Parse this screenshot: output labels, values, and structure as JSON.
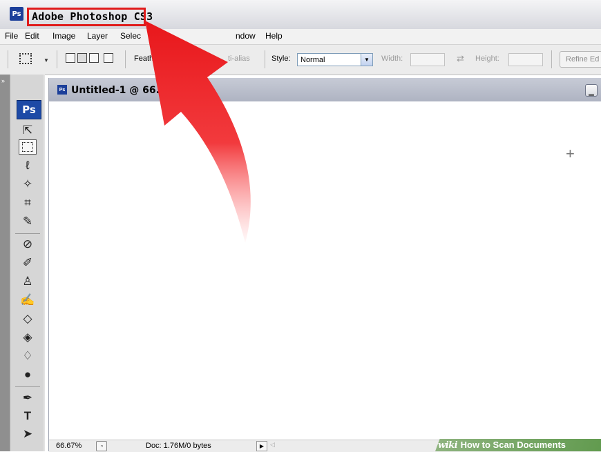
{
  "titlebar": {
    "app_icon": "Ps",
    "title": "Adobe Photoshop CS3"
  },
  "menu": [
    "File",
    "Edit",
    "Image",
    "Layer",
    "Selec",
    "ndow",
    "Help"
  ],
  "options_bar": {
    "feather_label": "Feath",
    "antialias_label": "ti-alias",
    "style_label": "Style:",
    "style_value": "Normal",
    "width_label": "Width:",
    "height_label": "Height:",
    "refine_label": "Refine Ed"
  },
  "toolbox": {
    "logo": "Ps",
    "icons": [
      "move-icon",
      "rectangular-marquee-icon",
      "lasso-icon",
      "magic-wand-icon",
      "crop-icon",
      "slice-icon",
      "healing-brush-icon",
      "brush-icon",
      "clone-stamp-icon",
      "history-brush-icon",
      "eraser-icon",
      "paint-bucket-icon",
      "blur-icon",
      "dodge-icon",
      "pen-icon",
      "type-icon",
      "path-selection-icon"
    ]
  },
  "document": {
    "icon": "Ps",
    "title": "Untitled-1 @ 66."
  },
  "status": {
    "zoom": "66.67%",
    "doc_info": "Doc: 1.76M/0 bytes"
  },
  "watermark": {
    "wiki": "wiki",
    "text": "How to Scan Documents"
  },
  "colors": {
    "highlight": "#e01b1b",
    "arrow": "#e8171b",
    "ps_blue": "#1d4aa6"
  }
}
